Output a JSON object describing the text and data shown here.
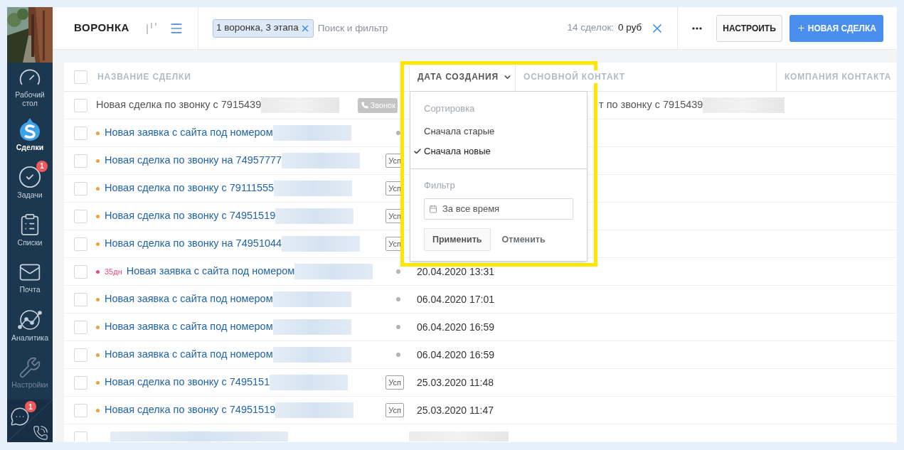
{
  "sidebar": {
    "items": [
      {
        "kind": "dashboard",
        "label": "Рабочий стол",
        "selected": false
      },
      {
        "kind": "deals",
        "label": "Сделки",
        "selected": true
      },
      {
        "kind": "tasks",
        "label": "Задачи",
        "selected": false,
        "badge": "1"
      },
      {
        "kind": "lists",
        "label": "Списки",
        "selected": false
      },
      {
        "kind": "mail",
        "label": "Почта",
        "selected": false
      },
      {
        "kind": "analytics",
        "label": "Аналитика",
        "selected": false
      },
      {
        "kind": "settings",
        "label": "Настройки",
        "selected": false
      }
    ],
    "chat_badge": "1"
  },
  "topbar": {
    "title": "ВОРОНКА",
    "views": [
      {
        "kind": "pipeline",
        "selected": false
      },
      {
        "kind": "list",
        "selected": true
      }
    ],
    "filter_chip": "1 воронка, 3 этапа",
    "search_placeholder": "Поиск и фильтр",
    "summary_label": "14 сделок:",
    "summary_value": "0 руб",
    "buttons": [
      {
        "kind": "secondary",
        "label": "НАСТРОИТЬ"
      },
      {
        "kind": "primary",
        "label": "НОВАЯ СДЕЛКА"
      }
    ]
  },
  "table": {
    "header_checked": false,
    "columns": [
      {
        "label": "НАЗВАНИЕ СДЕЛКИ",
        "sorted": false
      },
      {
        "label": "ДАТА СОЗДАНИЯ",
        "sorted": true
      },
      {
        "label": "ОСНОВНОЙ КОНТАКТ",
        "sorted": false
      },
      {
        "label": "КОМПАНИЯ КОНТАКТА",
        "sorted": false
      }
    ],
    "rows": [
      {
        "kind": "closed",
        "checked": false,
        "title": "Новая сделка по звонку с 7915439",
        "marker": {
          "kind": "call",
          "label": "Звонок"
        },
        "contact": "т по звонку с 7915439"
      },
      {
        "kind": "active",
        "checked": false,
        "color": "#e8a33d",
        "title": "Новая заявка с сайта под номером",
        "marker": {
          "kind": "dot"
        }
      },
      {
        "kind": "active",
        "checked": false,
        "color": "#e8a33d",
        "title": "Новая сделка по звонку на 74957777",
        "marker": {
          "kind": "tag",
          "label": "Усп"
        }
      },
      {
        "kind": "active",
        "checked": false,
        "color": "#e8a33d",
        "title": "Новая сделка по звонку с 79111555",
        "marker": {
          "kind": "tag",
          "label": "Усп"
        }
      },
      {
        "kind": "active",
        "checked": false,
        "color": "#e8a33d",
        "title": "Новая сделка по звонку с 74951519",
        "marker": {
          "kind": "tag",
          "label": "Усп"
        }
      },
      {
        "kind": "active",
        "checked": false,
        "color": "#e8a33d",
        "title": "Новая сделка по звонку на 74951044",
        "marker": {
          "kind": "tag",
          "label": "Усп"
        }
      },
      {
        "kind": "active",
        "checked": false,
        "color": "#e8478b",
        "age": "35дн",
        "title": "Новая заявка с сайта под номером",
        "marker": {
          "kind": "dot"
        },
        "date": "20.04.2020 13:31"
      },
      {
        "kind": "active",
        "checked": false,
        "color": "#e8a33d",
        "title": "Новая заявка с сайта под номером",
        "marker": {
          "kind": "dot"
        },
        "date": "06.04.2020 17:01"
      },
      {
        "kind": "active",
        "checked": false,
        "color": "#e8a33d",
        "title": "Новая заявка с сайта под номером",
        "marker": {
          "kind": "dot"
        },
        "date": "06.04.2020 16:59"
      },
      {
        "kind": "active",
        "checked": false,
        "color": "#e8a33d",
        "title": "Новая заявка с сайта под номером",
        "marker": {
          "kind": "dot"
        },
        "date": "06.04.2020 16:59"
      },
      {
        "kind": "active",
        "checked": false,
        "color": "#e8a33d",
        "title": "Новая сделка по звонку с 7495151",
        "marker": {
          "kind": "tag",
          "label": "Усп"
        },
        "date": "25.03.2020 11:48"
      },
      {
        "kind": "active",
        "checked": false,
        "color": "#e8a33d",
        "title": "Новая сделка по звонку с 74951519",
        "marker": {
          "kind": "tag",
          "label": "Усп"
        },
        "date": "25.03.2020 11:47"
      },
      {
        "kind": "blurred",
        "checked": false
      }
    ]
  },
  "dropdown": {
    "sort_label": "Сортировка",
    "sort_options": [
      {
        "label": "Сначала старые",
        "selected": false
      },
      {
        "label": "Сначала новые",
        "selected": true
      }
    ],
    "filter_label": "Фильтр",
    "period": "За все время",
    "apply": "Применить",
    "cancel": "Отменить"
  }
}
